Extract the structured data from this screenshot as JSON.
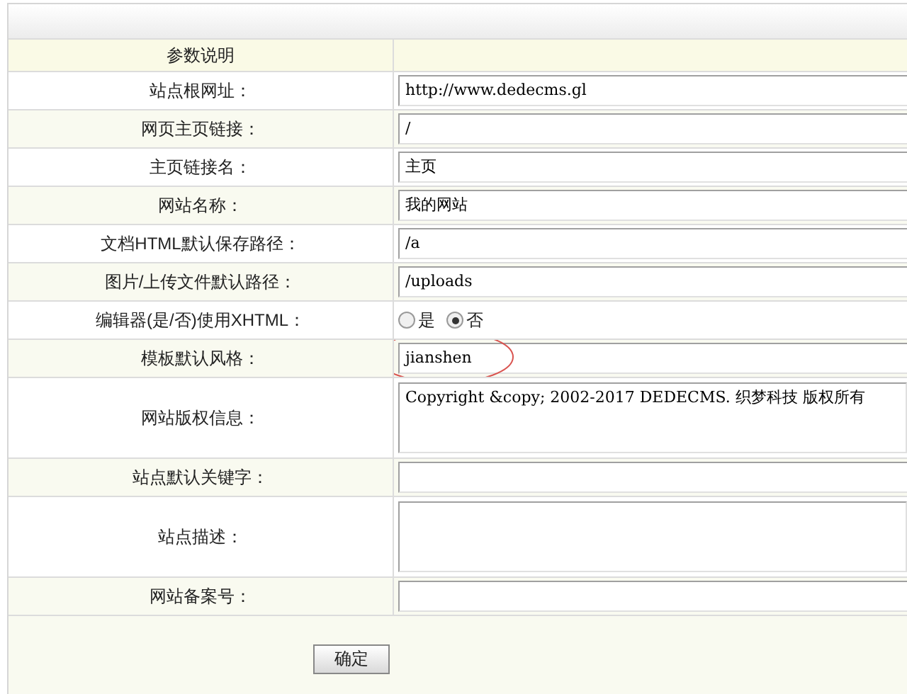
{
  "table": {
    "header": "参数说明",
    "rows": [
      {
        "label": "站点根网址：",
        "kind": "text",
        "value": "http://www.dedecms.gl"
      },
      {
        "label": "网页主页链接：",
        "kind": "text",
        "value": "/"
      },
      {
        "label": "主页链接名：",
        "kind": "text",
        "value": "主页"
      },
      {
        "label": "网站名称：",
        "kind": "text",
        "value": "我的网站"
      },
      {
        "label": "文档HTML默认保存路径：",
        "kind": "text",
        "value": "/a"
      },
      {
        "label": "图片/上传文件默认路径：",
        "kind": "text",
        "value": "/uploads"
      },
      {
        "label": "编辑器(是/否)使用XHTML：",
        "kind": "radio",
        "options": [
          {
            "label": "是",
            "selected": false
          },
          {
            "label": "否",
            "selected": true
          }
        ]
      },
      {
        "label": "模板默认风格：",
        "kind": "text",
        "value": "jianshen",
        "highlighted": true
      },
      {
        "label": "网站版权信息：",
        "kind": "textarea",
        "value": "Copyright &copy; 2002-2017 DEDECMS. 织梦科技 版权所有"
      },
      {
        "label": "站点默认关键字：",
        "kind": "text"
      },
      {
        "label": "站点描述：",
        "kind": "textarea"
      },
      {
        "label": "网站备案号：",
        "kind": "text"
      }
    ]
  },
  "submit": "确定"
}
